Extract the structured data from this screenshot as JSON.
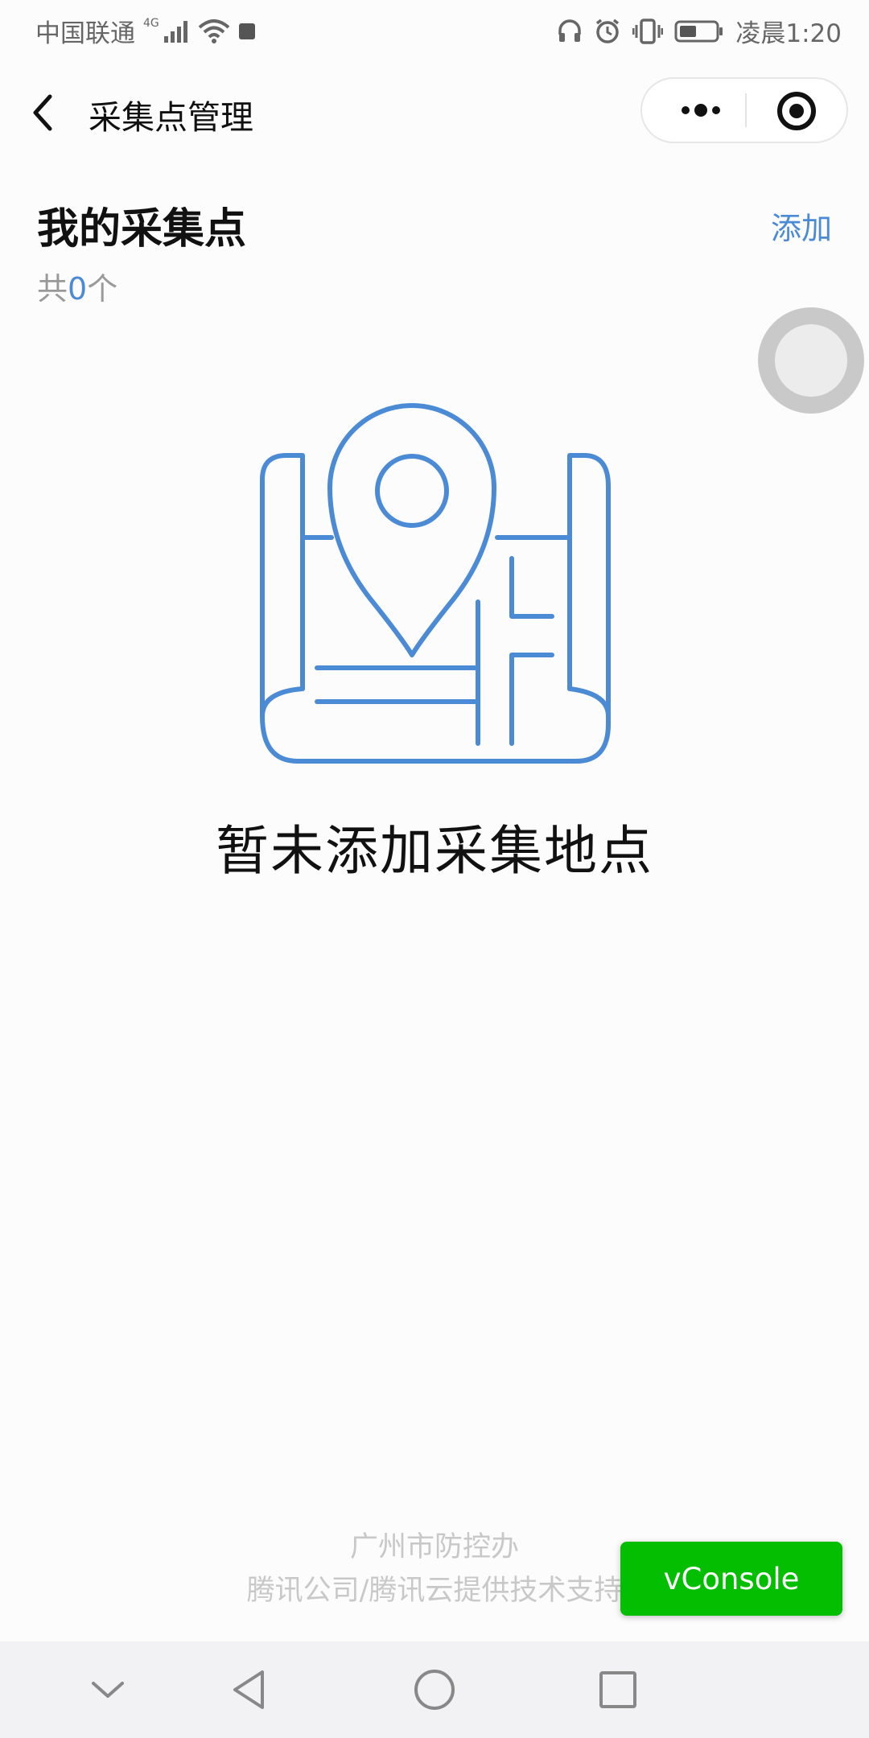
{
  "status_bar": {
    "carrier": "中国联通",
    "network": "4G",
    "time": "凌晨1:20"
  },
  "nav": {
    "title": "采集点管理"
  },
  "header": {
    "title": "我的采集点",
    "add_label": "添加",
    "count_prefix": "共",
    "count_value": "0",
    "count_suffix": "个"
  },
  "empty_state": {
    "message": "暂未添加采集地点",
    "icon": "map-pin-icon",
    "accent_color": "#4b8ad4"
  },
  "footer": {
    "line1": "广州市防控办",
    "line2": "腾讯公司/腾讯云提供技术支持"
  },
  "vconsole": {
    "label": "vConsole",
    "color": "#04be02"
  },
  "android_nav": {
    "icons": [
      "chevron-down-icon",
      "back-triangle-icon",
      "home-circle-icon",
      "recents-square-icon"
    ]
  }
}
